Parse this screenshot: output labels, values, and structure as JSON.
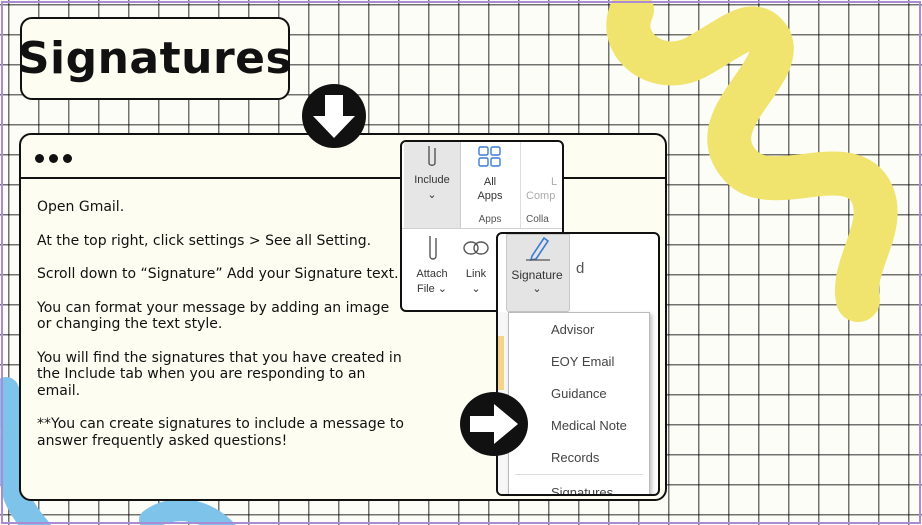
{
  "title": "Signatures",
  "instructions": [
    "Open Gmail.",
    "At the top right, click settings > See all Setting.",
    "Scroll down to “Signature” Add your Signature text.",
    "You can format your message by adding an image or changing the text style.",
    "You will find the signatures that you have created in the Include tab when you are responding to an email.",
    "**You can create signatures to include a message to answer frequently asked questions!"
  ],
  "ribbon": {
    "include_label": "Include",
    "all_apps_label_1": "All",
    "all_apps_label_2": "Apps",
    "apps_group_label": "Apps",
    "compose_label_1": "L",
    "compose_label_2": "Comp",
    "collab_label": "Colla",
    "attach_label_1": "Attach",
    "attach_label_2": "File",
    "link_label": "Link"
  },
  "signature_menu": {
    "button_label": "Signature",
    "partial_text": "d",
    "items": [
      "Advisor",
      "EOY Email",
      "Guidance",
      "Medical Note",
      "Records"
    ],
    "footer_item": "Signatures..."
  },
  "colors": {
    "yellow_squiggle": "#f0e46e",
    "blue_squiggle": "#7ec3ea",
    "frame": "#a98bd6"
  }
}
